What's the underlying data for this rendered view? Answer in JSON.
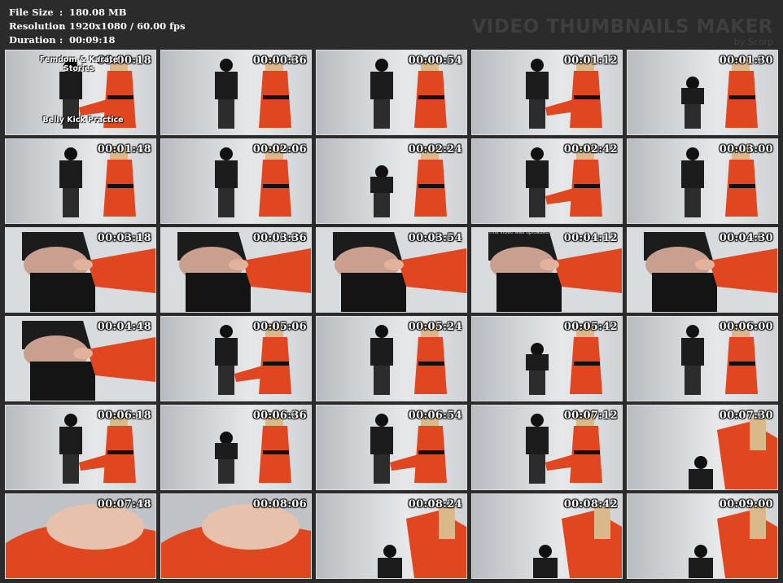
{
  "header": {
    "file_size_label": "File Size",
    "file_size_value": "180.08 MB",
    "resolution_label": "Resolution",
    "resolution_value": "1920x1080 / 60.00 fps",
    "duration_label": "Duration",
    "duration_value": "00:09:18",
    "separator": ":"
  },
  "watermark": {
    "title": "VIDEO THUMBNAILS MAKER",
    "subtitle": "by Scorp"
  },
  "thumbnails": [
    {
      "time": "00:00:18"
    },
    {
      "time": "00:00:36"
    },
    {
      "time": "00:00:54"
    },
    {
      "time": "00:01:12"
    },
    {
      "time": "00:01:30"
    },
    {
      "time": "00:01:48"
    },
    {
      "time": "00:02:06"
    },
    {
      "time": "00:02:24"
    },
    {
      "time": "00:02:42"
    },
    {
      "time": "00:03:00"
    },
    {
      "time": "00:03:18"
    },
    {
      "time": "00:03:36"
    },
    {
      "time": "00:03:54"
    },
    {
      "time": "00:04:12"
    },
    {
      "time": "00:04:30"
    },
    {
      "time": "00:04:48"
    },
    {
      "time": "00:05:06"
    },
    {
      "time": "00:05:24"
    },
    {
      "time": "00:05:42"
    },
    {
      "time": "00:06:00"
    },
    {
      "time": "00:06:18"
    },
    {
      "time": "00:06:36"
    },
    {
      "time": "00:06:54"
    },
    {
      "time": "00:07:12"
    },
    {
      "time": "00:07:30"
    },
    {
      "time": "00:07:48"
    },
    {
      "time": "00:08:06"
    },
    {
      "time": "00:08:24"
    },
    {
      "time": "00:08:42"
    },
    {
      "time": "00:09:00"
    }
  ],
  "first_frame_overlay": {
    "line1": "Femdom & Karate",
    "line2": "Stories",
    "line3": "Belly Kick Practice"
  },
  "row3_note": "This video was uploaded to WWW.XVIDEOS.COM",
  "colors": {
    "background": "#2b2b2b",
    "gi": "#e0461f",
    "shirt": "#1c1c1c",
    "wall": "#d8dbde"
  }
}
